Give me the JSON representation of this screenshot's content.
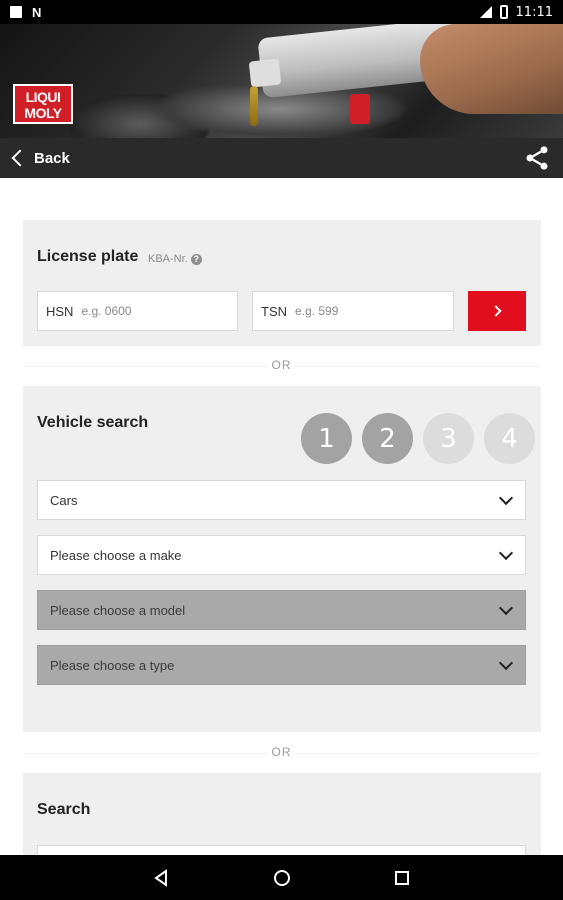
{
  "status_bar": {
    "time": "11:11",
    "notification_letter": "N"
  },
  "hero": {
    "brand_logo_line1": "LIQUI",
    "brand_logo_line2": "MOLY"
  },
  "navbar": {
    "back_label": "Back"
  },
  "license_plate": {
    "title": "License plate",
    "kba_label": "KBA-Nr.",
    "help_glyph": "?",
    "hsn_prefix": "HSN",
    "hsn_placeholder": "e.g. 0600",
    "tsn_prefix": "TSN",
    "tsn_placeholder": "e.g. 599"
  },
  "separators": {
    "or_1": "OR",
    "or_2": "OR"
  },
  "vehicle_search": {
    "title": "Vehicle search",
    "steps": [
      {
        "label": "1",
        "state": "done"
      },
      {
        "label": "2",
        "state": "done"
      },
      {
        "label": "3",
        "state": "todo"
      },
      {
        "label": "4",
        "state": "todo"
      }
    ],
    "selects": [
      {
        "value": "Cars",
        "enabled": true
      },
      {
        "value": "Please choose a make",
        "enabled": true
      },
      {
        "value": "Please choose a model",
        "enabled": false
      },
      {
        "value": "Please choose a type",
        "enabled": false
      }
    ]
  },
  "search": {
    "title": "Search"
  },
  "colors": {
    "accent_red": "#e10e1d",
    "navbar_bg": "#2a2a2a",
    "card_bg": "#efefef"
  },
  "icons": {
    "back": "chevron-left-icon",
    "share": "share-icon",
    "go": "chevron-right-icon",
    "help": "help-icon",
    "select": "chevron-down-icon",
    "android_back": "triangle-back-icon",
    "android_home": "circle-home-icon",
    "android_recents": "square-recents-icon"
  }
}
